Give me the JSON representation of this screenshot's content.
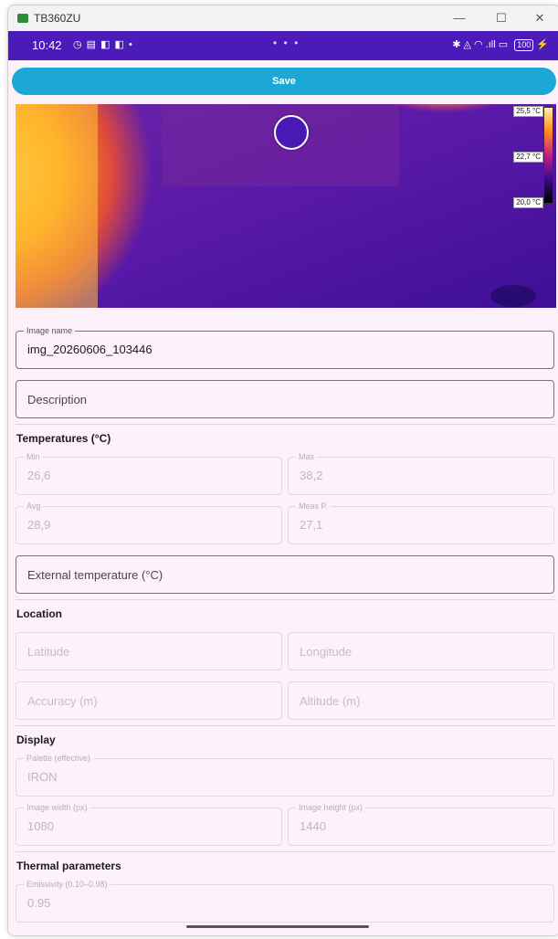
{
  "window": {
    "title": "TB360ZU",
    "minimize": "—",
    "maximize": "☐",
    "close": "✕"
  },
  "statusbar": {
    "time": "10:42",
    "left_icons": "◷ ▤ ◧ ◧ •",
    "dots": "• • •",
    "right_icons": "✱ ◬ ◠ .ıll ▭",
    "battery": "100",
    "charge": "⚡"
  },
  "save_label": "Save",
  "thermal": {
    "scale": [
      "25,5 °C",
      "22,7 °C",
      "20,0 °C"
    ]
  },
  "image_name": {
    "label": "Image name",
    "value": "img_20260606_103446"
  },
  "description": {
    "placeholder": "Description"
  },
  "temperatures": {
    "title": "Temperatures (°C)",
    "min": {
      "label": "Min",
      "value": "26,6"
    },
    "max": {
      "label": "Max",
      "value": "38,2"
    },
    "avg": {
      "label": "Avg",
      "value": "28,9"
    },
    "meas": {
      "label": "Meas P.",
      "value": "27,1"
    },
    "external": {
      "placeholder": "External temperature (°C)"
    }
  },
  "location": {
    "title": "Location",
    "latitude": "Latitude",
    "longitude": "Longitude",
    "accuracy": "Accuracy (m)",
    "altitude": "Altitude (m)"
  },
  "display": {
    "title": "Display",
    "palette": {
      "label": "Palette (effective)",
      "value": "IRON"
    },
    "width": {
      "label": "Image width (px)",
      "value": "1080"
    },
    "height": {
      "label": "Image height (px)",
      "value": "1440"
    }
  },
  "thermal_params": {
    "title": "Thermal parameters",
    "emissivity": {
      "label": "Emissivity (0.10–0.98)",
      "value": "0.95"
    }
  },
  "colors": {
    "status_bar": "#4a1bb8",
    "save_button": "#1ba8d6",
    "background": "#fdf2fa"
  }
}
